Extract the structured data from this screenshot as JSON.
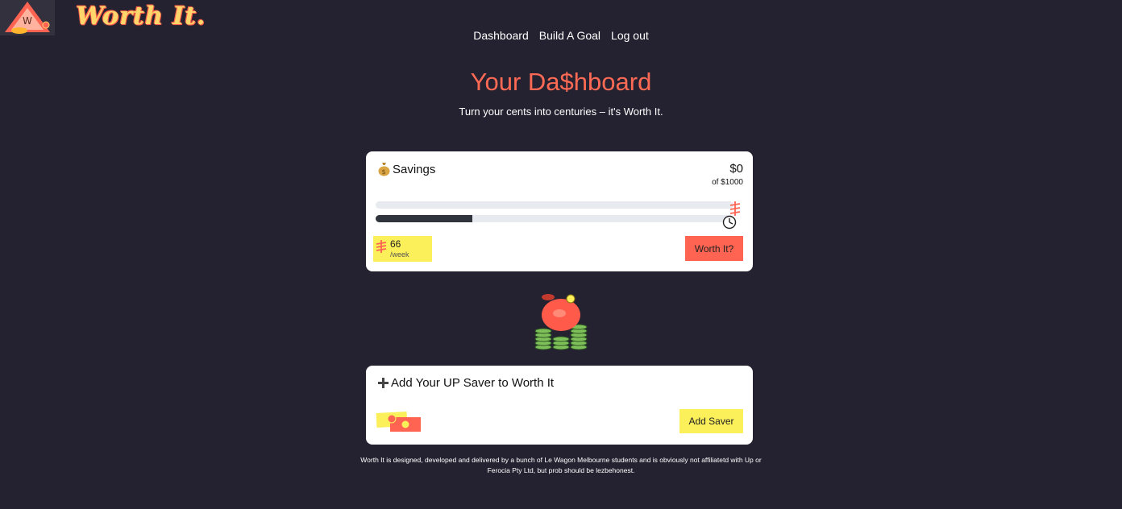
{
  "brand": {
    "wordmark": "Worth It."
  },
  "nav": {
    "items": [
      "Dashboard",
      "Build A Goal",
      "Log out"
    ]
  },
  "page": {
    "title": "Your Da$hboard",
    "subtitle": "Turn your cents into centuries – it's Worth It."
  },
  "savings_card": {
    "icon": "money-bag-icon",
    "title": "Savings",
    "amount": "$0",
    "of_amount": "of $1000",
    "savings_progress": 0,
    "time_progress": 0.27,
    "rate_value": "66",
    "rate_unit": "/week",
    "button_label": "Worth It?"
  },
  "saver_card": {
    "icon": "plus-icon",
    "title": "Add Your UP Saver to Worth It",
    "button_label": "Add Saver"
  },
  "footer": {
    "text": "Worth It is designed, developed and delivered by a bunch of Le Wagon Melbourne students and is obviously not affiliatetd with Up or Ferocia Pty Ltd, but prob should be lezbehonest."
  },
  "colors": {
    "background": "#242230",
    "accent_red": "#ff6352",
    "accent_yellow": "#fbef5a",
    "card": "#ffffff"
  }
}
